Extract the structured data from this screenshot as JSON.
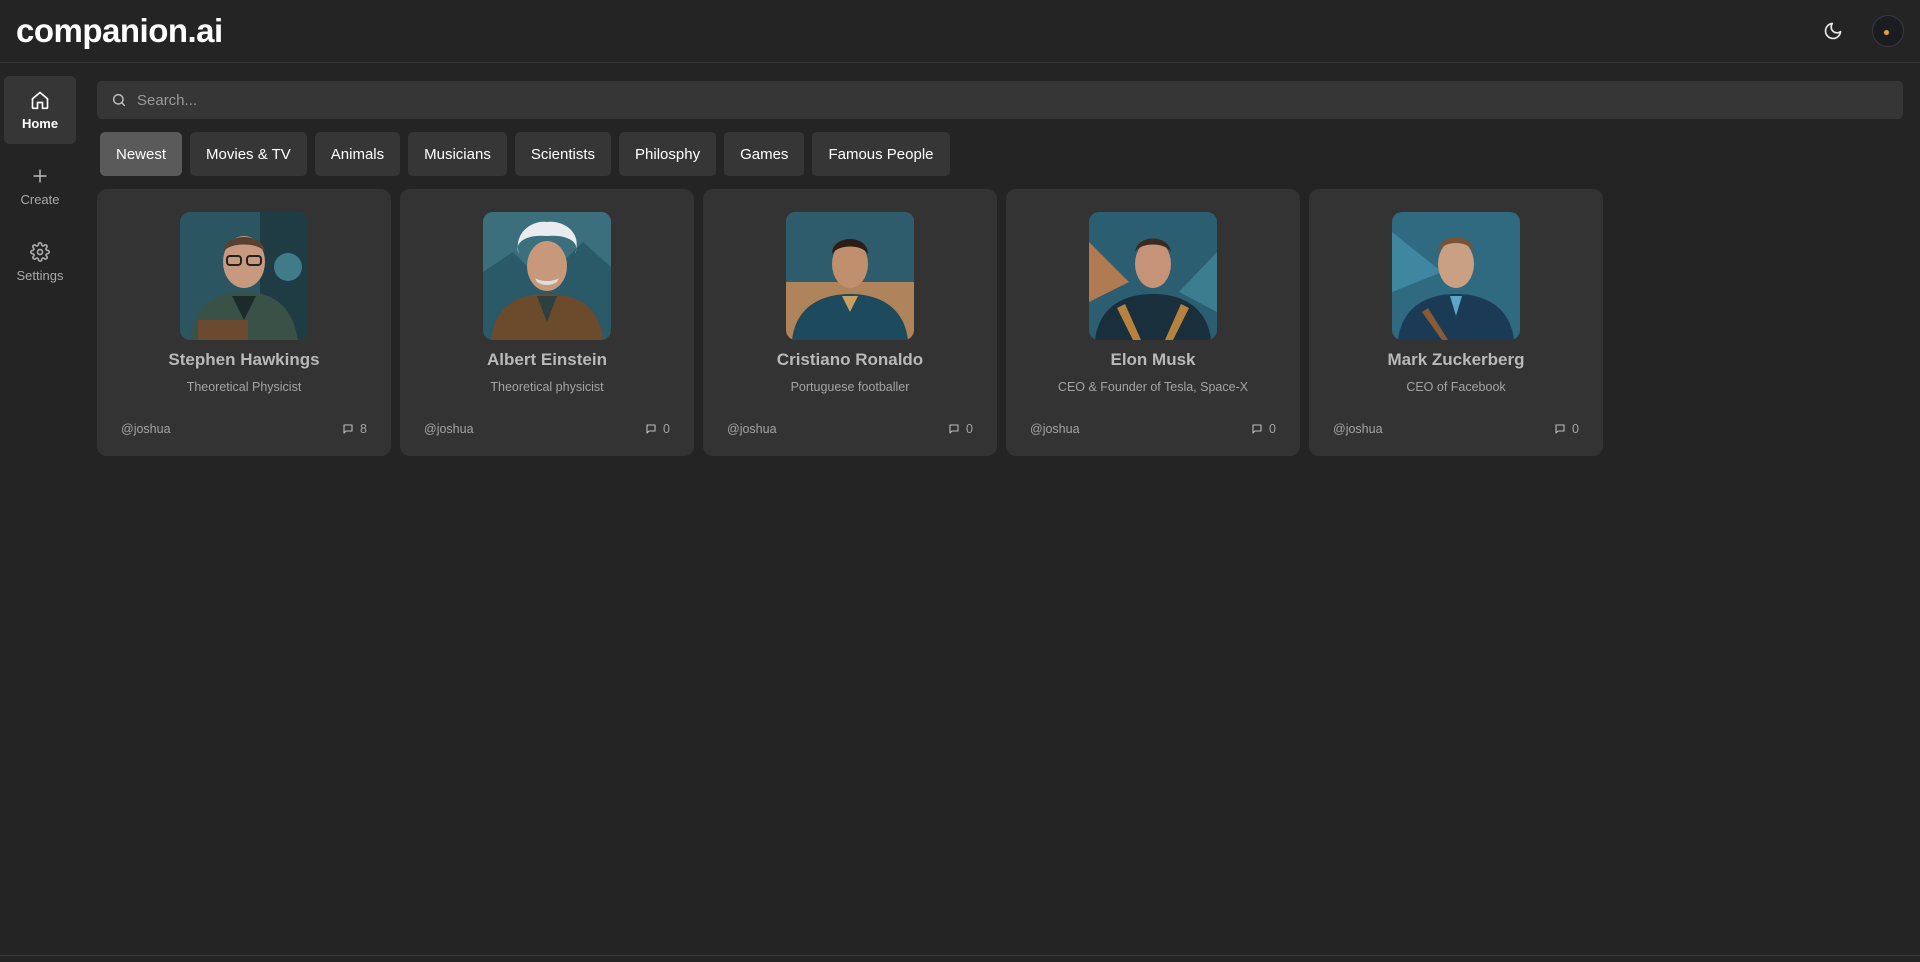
{
  "app": {
    "logo": "companion.ai"
  },
  "header": {
    "theme_icon": "moon-icon",
    "avatar_icon": "avatar"
  },
  "sidebar": {
    "items": [
      {
        "label": "Home",
        "icon": "home-icon",
        "active": true
      },
      {
        "label": "Create",
        "icon": "plus-icon",
        "active": false
      },
      {
        "label": "Settings",
        "icon": "gear-icon",
        "active": false
      }
    ]
  },
  "search": {
    "placeholder": "Search..."
  },
  "categories": [
    {
      "label": "Newest",
      "active": true
    },
    {
      "label": "Movies & TV"
    },
    {
      "label": "Animals"
    },
    {
      "label": "Musicians"
    },
    {
      "label": "Scientists"
    },
    {
      "label": "Philosphy"
    },
    {
      "label": "Games"
    },
    {
      "label": "Famous People"
    }
  ],
  "companions": [
    {
      "name": "Stephen Hawkings",
      "description": "Theoretical Physicist",
      "author": "@joshua",
      "messages": "8"
    },
    {
      "name": "Albert Einstein",
      "description": "Theoretical physicist",
      "author": "@joshua",
      "messages": "0"
    },
    {
      "name": "Cristiano Ronaldo",
      "description": "Portuguese footballer",
      "author": "@joshua",
      "messages": "0"
    },
    {
      "name": "Elon Musk",
      "description": "CEO & Founder of Tesla, Space-X",
      "author": "@joshua",
      "messages": "0"
    },
    {
      "name": "Mark Zuckerberg",
      "description": "CEO of Facebook",
      "author": "@joshua",
      "messages": "0"
    }
  ],
  "colors": {
    "background": "#242424",
    "surface": "#333333",
    "chip": "#363636",
    "chip_active": "#5a5a5a"
  }
}
